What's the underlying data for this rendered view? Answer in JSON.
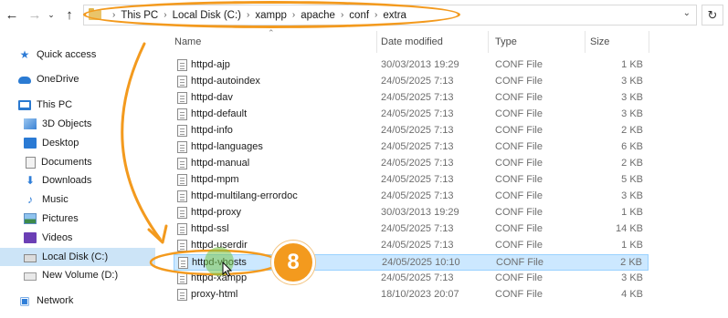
{
  "window": {
    "breadcrumb": [
      "This PC",
      "Local Disk (C:)",
      "xampp",
      "apache",
      "conf",
      "extra"
    ],
    "nav_icons": {
      "back": "back-arrow-icon",
      "forward": "forward-arrow-icon",
      "recent": "chevron-down-icon",
      "up": "up-arrow-icon",
      "refresh": "refresh-icon"
    }
  },
  "sidebar": {
    "items": [
      {
        "label": "Quick access",
        "icon": "star-icon"
      },
      {
        "label": "OneDrive",
        "icon": "cloud-icon"
      },
      {
        "label": "This PC",
        "icon": "computer-icon"
      },
      {
        "label": "3D Objects",
        "icon": "cube-icon"
      },
      {
        "label": "Desktop",
        "icon": "desktop-icon"
      },
      {
        "label": "Documents",
        "icon": "documents-icon"
      },
      {
        "label": "Downloads",
        "icon": "download-icon"
      },
      {
        "label": "Music",
        "icon": "music-icon"
      },
      {
        "label": "Pictures",
        "icon": "pictures-icon"
      },
      {
        "label": "Videos",
        "icon": "videos-icon"
      },
      {
        "label": "Local Disk (C:)",
        "icon": "drive-icon",
        "active": true
      },
      {
        "label": "New Volume (D:)",
        "icon": "drive-icon"
      },
      {
        "label": "Network",
        "icon": "network-icon"
      }
    ]
  },
  "columns": {
    "name": "Name",
    "date": "Date modified",
    "type": "Type",
    "size": "Size"
  },
  "files": [
    {
      "name": "httpd-ajp",
      "date": "30/03/2013 19:29",
      "type": "CONF File",
      "size": "1 KB"
    },
    {
      "name": "httpd-autoindex",
      "date": "24/05/2025 7:13",
      "type": "CONF File",
      "size": "3 KB"
    },
    {
      "name": "httpd-dav",
      "date": "24/05/2025 7:13",
      "type": "CONF File",
      "size": "3 KB"
    },
    {
      "name": "httpd-default",
      "date": "24/05/2025 7:13",
      "type": "CONF File",
      "size": "3 KB"
    },
    {
      "name": "httpd-info",
      "date": "24/05/2025 7:13",
      "type": "CONF File",
      "size": "2 KB"
    },
    {
      "name": "httpd-languages",
      "date": "24/05/2025 7:13",
      "type": "CONF File",
      "size": "6 KB"
    },
    {
      "name": "httpd-manual",
      "date": "24/05/2025 7:13",
      "type": "CONF File",
      "size": "2 KB"
    },
    {
      "name": "httpd-mpm",
      "date": "24/05/2025 7:13",
      "type": "CONF File",
      "size": "5 KB"
    },
    {
      "name": "httpd-multilang-errordoc",
      "date": "24/05/2025 7:13",
      "type": "CONF File",
      "size": "3 KB"
    },
    {
      "name": "httpd-proxy",
      "date": "30/03/2013 19:29",
      "type": "CONF File",
      "size": "1 KB"
    },
    {
      "name": "httpd-ssl",
      "date": "24/05/2025 7:13",
      "type": "CONF File",
      "size": "14 KB"
    },
    {
      "name": "httpd-userdir",
      "date": "24/05/2025 7:13",
      "type": "CONF File",
      "size": "1 KB"
    },
    {
      "name": "httpd-vhosts",
      "date": "24/05/2025 10:10",
      "type": "CONF File",
      "size": "2 KB",
      "selected": true
    },
    {
      "name": "httpd-xampp",
      "date": "24/05/2025 7:13",
      "type": "CONF File",
      "size": "3 KB"
    },
    {
      "name": "proxy-html",
      "date": "18/10/2023 20:07",
      "type": "CONF File",
      "size": "4 KB"
    }
  ],
  "annotation": {
    "step_number": "8",
    "accent_color": "#f39a1e"
  },
  "colors": {
    "selection": "#cce8ff",
    "sidebar_active": "#cce4f7"
  }
}
